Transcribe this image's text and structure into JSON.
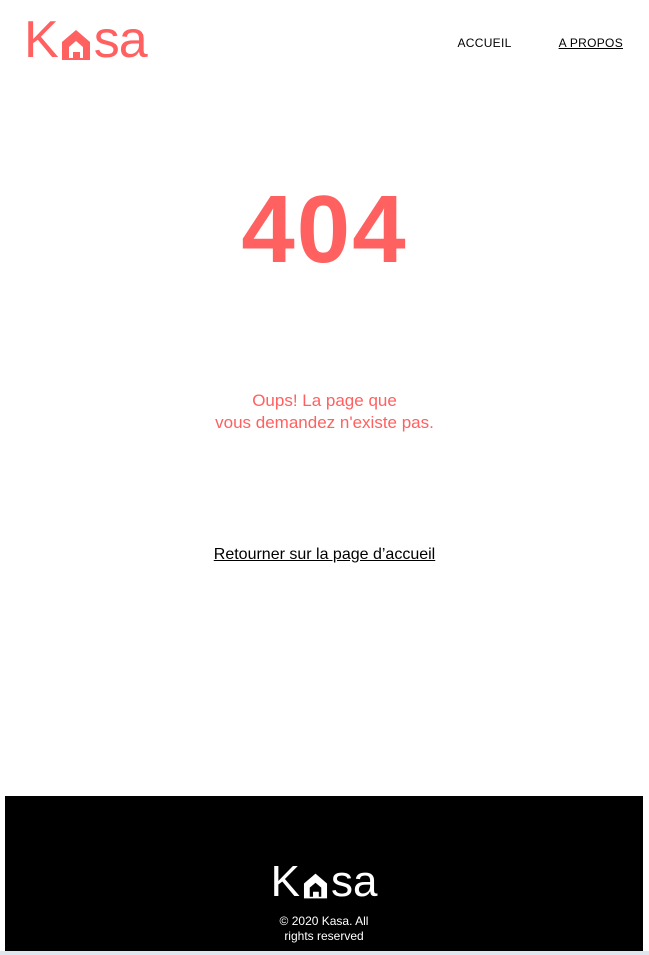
{
  "brand": {
    "name_first": "K",
    "name_rest": "sa",
    "accent_color": "#FF6060"
  },
  "nav": {
    "items": [
      {
        "label": "ACCUEIL",
        "active": false
      },
      {
        "label": "A PROPOS",
        "active": true
      }
    ]
  },
  "error": {
    "code": "404",
    "message_line1": "Oups! La page que",
    "message_line2": "vous demandez n'existe pas.",
    "home_link": "Retourner sur la page d’accueil"
  },
  "footer": {
    "copyright_line1": "© 2020 Kasa. All",
    "copyright_line2": "rights reserved",
    "background": "#000000"
  },
  "icons": {
    "logo_house": "house-icon"
  }
}
